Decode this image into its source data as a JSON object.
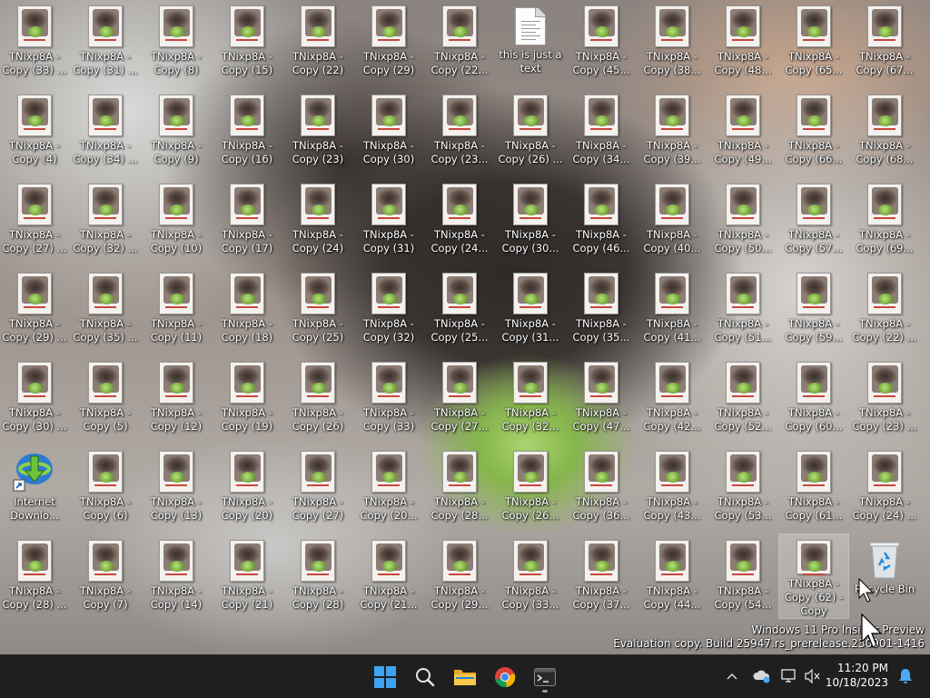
{
  "desktop": {
    "columns": [
      [
        "TNixp8A -\nCopy (33) ...",
        "TNixp8A -\nCopy (4)",
        "TNixp8A -\nCopy (27) ...",
        "TNixp8A -\nCopy (29) ...",
        "TNixp8A -\nCopy (30) ...",
        "Internet\nDownlo...",
        "TNixp8A -\nCopy (28) ..."
      ],
      [
        "TNixp8A -\nCopy (31) ...",
        "TNixp8A -\nCopy (34) ...",
        "TNixp8A -\nCopy (32) ...",
        "TNixp8A -\nCopy (35) ...",
        "TNixp8A -\nCopy (5)",
        "TNixp8A -\nCopy (6)",
        "TNixp8A -\nCopy (7)"
      ],
      [
        "TNixp8A -\nCopy (8)",
        "TNixp8A -\nCopy (9)",
        "TNixp8A -\nCopy (10)",
        "TNixp8A -\nCopy (11)",
        "TNixp8A -\nCopy (12)",
        "TNixp8A -\nCopy (13)",
        "TNixp8A -\nCopy (14)"
      ],
      [
        "TNixp8A -\nCopy (15)",
        "TNixp8A -\nCopy (16)",
        "TNixp8A -\nCopy (17)",
        "TNixp8A -\nCopy (18)",
        "TNixp8A -\nCopy (19)",
        "TNixp8A -\nCopy (20)",
        "TNixp8A -\nCopy (21)"
      ],
      [
        "TNixp8A -\nCopy (22)",
        "TNixp8A -\nCopy (23)",
        "TNixp8A -\nCopy (24)",
        "TNixp8A -\nCopy (25)",
        "TNixp8A -\nCopy (26)",
        "TNixp8A -\nCopy (27)",
        "TNixp8A -\nCopy (28)"
      ],
      [
        "TNixp8A -\nCopy (29)",
        "TNixp8A -\nCopy (30)",
        "TNixp8A -\nCopy (31)",
        "TNixp8A -\nCopy (32)",
        "TNixp8A -\nCopy (33)",
        "TNixp8A -\nCopy (20...",
        "TNixp8A -\nCopy (21..."
      ],
      [
        "TNixp8A -\nCopy (22...",
        "TNixp8A -\nCopy (23...",
        "TNixp8A -\nCopy (24...",
        "TNixp8A -\nCopy (25...",
        "TNixp8A -\nCopy (27...",
        "TNixp8A -\nCopy (28...",
        "TNixp8A -\nCopy (29..."
      ],
      [
        "this is just a\ntext",
        "TNixp8A -\nCopy (26) ...",
        "TNixp8A -\nCopy (30...",
        "TNixp8A -\nCopy (31...",
        "TNixp8A -\nCopy (32...",
        "TNixp8A -\nCopy (26...",
        "TNixp8A -\nCopy (33..."
      ],
      [
        "TNixp8A -\nCopy (45...",
        "TNixp8A -\nCopy (34...",
        "TNixp8A -\nCopy (46...",
        "TNixp8A -\nCopy (35...",
        "TNixp8A -\nCopy (47...",
        "TNixp8A -\nCopy (36...",
        "TNixp8A -\nCopy (37..."
      ],
      [
        "TNixp8A -\nCopy (38...",
        "TNixp8A -\nCopy (39...",
        "TNixp8A -\nCopy (40...",
        "TNixp8A -\nCopy (41...",
        "TNixp8A -\nCopy (42...",
        "TNixp8A -\nCopy (43...",
        "TNixp8A -\nCopy (44..."
      ],
      [
        "TNixp8A -\nCopy (48...",
        "TNixp8A -\nCopy (49...",
        "TNixp8A -\nCopy (50...",
        "TNixp8A -\nCopy (51...",
        "TNixp8A -\nCopy (52...",
        "TNixp8A -\nCopy (53...",
        "TNixp8A -\nCopy (54..."
      ],
      [
        "TNixp8A -\nCopy (65...",
        "TNixp8A -\nCopy (66...",
        "TNixp8A -\nCopy (57...",
        "TNixp8A -\nCopy (59...",
        "TNixp8A -\nCopy (60...",
        "TNixp8A -\nCopy (61...",
        "TNixp8A -\nCopy (62) -\nCopy"
      ],
      [
        "TNixp8A -\nCopy (67...",
        "TNixp8A -\nCopy (68...",
        "TNixp8A -\nCopy (69...",
        "TNixp8A -\nCopy (22) ...",
        "TNixp8A -\nCopy (23) ...",
        "TNixp8A -\nCopy (24) ...",
        "Recycle Bin"
      ]
    ],
    "selected": "TNixp8A -\nCopy (62) -\nCopy"
  },
  "watermark": {
    "line1": "Windows 11 Pro Insider Preview",
    "line2": "Evaluation copy. Build 25947.rs_prerelease.230901-1416"
  },
  "taskbar": {
    "apps": [
      {
        "name": "start-button",
        "icon": "windows-logo-icon"
      },
      {
        "name": "search-button",
        "icon": "search-icon"
      },
      {
        "name": "file-explorer-button",
        "icon": "folder-icon"
      },
      {
        "name": "chrome-button",
        "icon": "chrome-icon"
      },
      {
        "name": "terminal-button",
        "icon": "terminal-icon"
      }
    ],
    "tray": {
      "chevron": "^",
      "icons": [
        "chevron-up-icon",
        "onedrive-icon",
        "network-icon",
        "volume-muted-icon",
        "notification-bell-icon"
      ]
    },
    "clock": {
      "time": "11:20 PM",
      "date": "10/18/2023"
    }
  },
  "colors": {
    "taskbar_bg": "#1f1f1f",
    "accent_blue": "#3ea3f0",
    "notification_blue": "#4aa8f5"
  }
}
